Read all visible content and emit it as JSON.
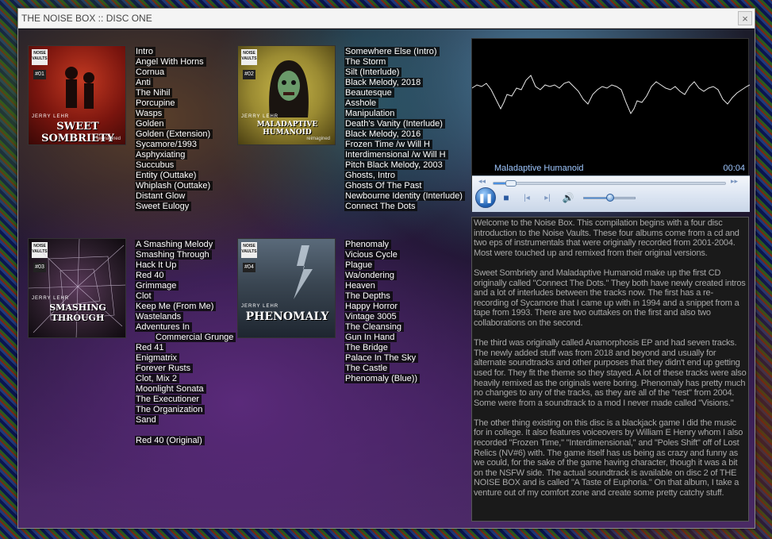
{
  "window": {
    "title": "THE NOISE BOX :: DISC ONE",
    "close_label": "×"
  },
  "albums": [
    {
      "cover": {
        "brand": "NOISE VAULTS",
        "number": "#01",
        "artist": "JERRY LEHR",
        "title": "SWEET SOMBRIETY",
        "subtitle": "reimagined",
        "bg": "#8a1e14"
      },
      "tracks": [
        "Intro",
        "Angel With Horns",
        "Cornua",
        "Anti",
        "The Nihil",
        "Porcupine",
        "Wasps",
        "Golden",
        "Golden (Extension)",
        "Sycamore/1993",
        "Asphyxiating",
        "Succubus",
        "Entity (Outtake)",
        "Whiplash (Outtake)",
        "Distant Glow",
        "Sweet Eulogy"
      ]
    },
    {
      "cover": {
        "brand": "NOISE VAULTS",
        "number": "#02",
        "artist": "JERRY LEHR",
        "title": "MALADAPTIVE HUMANOID",
        "subtitle": "reimagined",
        "bg": "#9a8a32"
      },
      "tracks": [
        "Somewhere Else (Intro)",
        "The Storm",
        "Silt (Interlude)",
        "Black Melody, 2018",
        "Beautesque",
        "Asshole",
        "Manipulation",
        "Death's Vanity (Interlude)",
        "Black Melody, 2016",
        "Frozen Time /w Will H",
        "Interdimensional /w Will H",
        "Pitch Black Melody, 2003",
        "Ghosts, Intro",
        "Ghosts Of The Past",
        "Newbourne Identity (Interlude)",
        "Connect The Dots"
      ]
    },
    {
      "cover": {
        "brand": "NOISE VAULTS",
        "number": "#03",
        "artist": "JERRY LEHR",
        "title": "SMASHING THROUGH",
        "subtitle": "",
        "bg": "#2a1d2a"
      },
      "tracks": [
        "A Smashing Melody",
        "Smashing Through",
        "Hack It Up",
        "Red 40",
        "Grimmage",
        "Clot",
        "Keep Me (From Me)",
        "Wastelands",
        "Adventures In",
        "Commercial Grunge",
        "Red 41",
        "Enigmatrix",
        "Forever Rusts",
        "Clot, Mix 2",
        "Moonlight Sonata",
        "The Executioner",
        "The Organization",
        "Sand",
        "",
        "Red 40 (Original)"
      ]
    },
    {
      "cover": {
        "brand": "NOISE VAULTS",
        "number": "#04",
        "artist": "JERRY LEHR",
        "title": "PHENOMALY",
        "subtitle": "",
        "bg": "#3a4652"
      },
      "tracks": [
        "Phenomaly",
        "Vicious Cycle",
        "Plague",
        "Wa/ondering",
        "Heaven",
        "The Depths",
        "Happy Horror",
        "Vintage 3005",
        "The Cleansing",
        "Gun In Hand",
        "The Bridge",
        "Palace In The Sky",
        "The Castle",
        "Phenomaly (Blue))"
      ]
    }
  ],
  "player": {
    "now_playing": "Maladaptive Humanoid",
    "time": "00:04",
    "progress_fraction": 0.05,
    "volume_fraction": 0.5,
    "icons": {
      "seek_back": "rewind-small-icon",
      "seek_fwd": "forward-small-icon",
      "play_pause": "pause-icon",
      "stop": "stop-icon",
      "prev": "previous-icon",
      "next": "next-icon",
      "volume": "volume-icon"
    }
  },
  "notes": [
    "Welcome to the Noise Box. This compilation begins with a four disc introduction to the Noise Vaults. These four albums come from a cd and two eps of instrumentals that were originally recorded from 2001-2004. Most were touched up and remixed from their original versions.",
    "Sweet Sombriety and Maladaptive Humanoid make up the first CD originally called \"Connect The Dots.\" They both have newly created intros and a lot of interludes between the tracks now. The first has a re-recording of Sycamore that I came up with in 1994 and a snippet from a tape from 1993. There are two outtakes on the first and also two collaborations on the second.",
    "The third was originally called Anamorphosis EP and had seven tracks. The newly added stuff was from 2018 and beyond and usually for alternate soundtracks and other purposes that they didn't end up getting used for. They fit the theme so they stayed. A lot of these tracks were also heavily remixed as the originals were boring. Phenomaly has pretty much no changes to any of the tracks, as they are all of the \"rest\" from 2004. Some were from a soundtrack to a mod I never made called \"Visions.\"",
    "The other thing existing on this disc is a blackjack game I did the music for in college. It also features voiceovers by William E Henry whom I also recorded \"Frozen Time,\" \"Interdimensional,\" and \"Poles Shift\" off of Lost Relics (NV#6) with. The game itself has us being as crazy and funny as we could, for the sake of the game having character, though it was a bit on the NSFW side. The actual soundtrack is available on disc 2 of THE NOISE BOX and is called \"A Taste of Euphoria.\" On that album, I take a venture out of my comfort zone and create some pretty catchy stuff."
  ]
}
